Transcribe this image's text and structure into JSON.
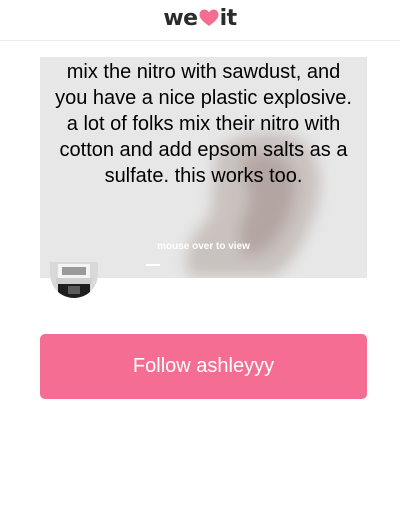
{
  "header": {
    "logo_left": "we",
    "logo_right": "it",
    "logo_icon": "heart-icon",
    "brand_color": "#f56d92"
  },
  "card": {
    "quote": "mix the nitro with sawdust, and you have a nice plastic explosive. a lot of folks mix their nitro with cotton and add epsom salts as a sulfate. this works too.",
    "hover_label": "mouse over to view"
  },
  "follow": {
    "label": "Follow ashleyyy",
    "color": "#f56d92"
  }
}
